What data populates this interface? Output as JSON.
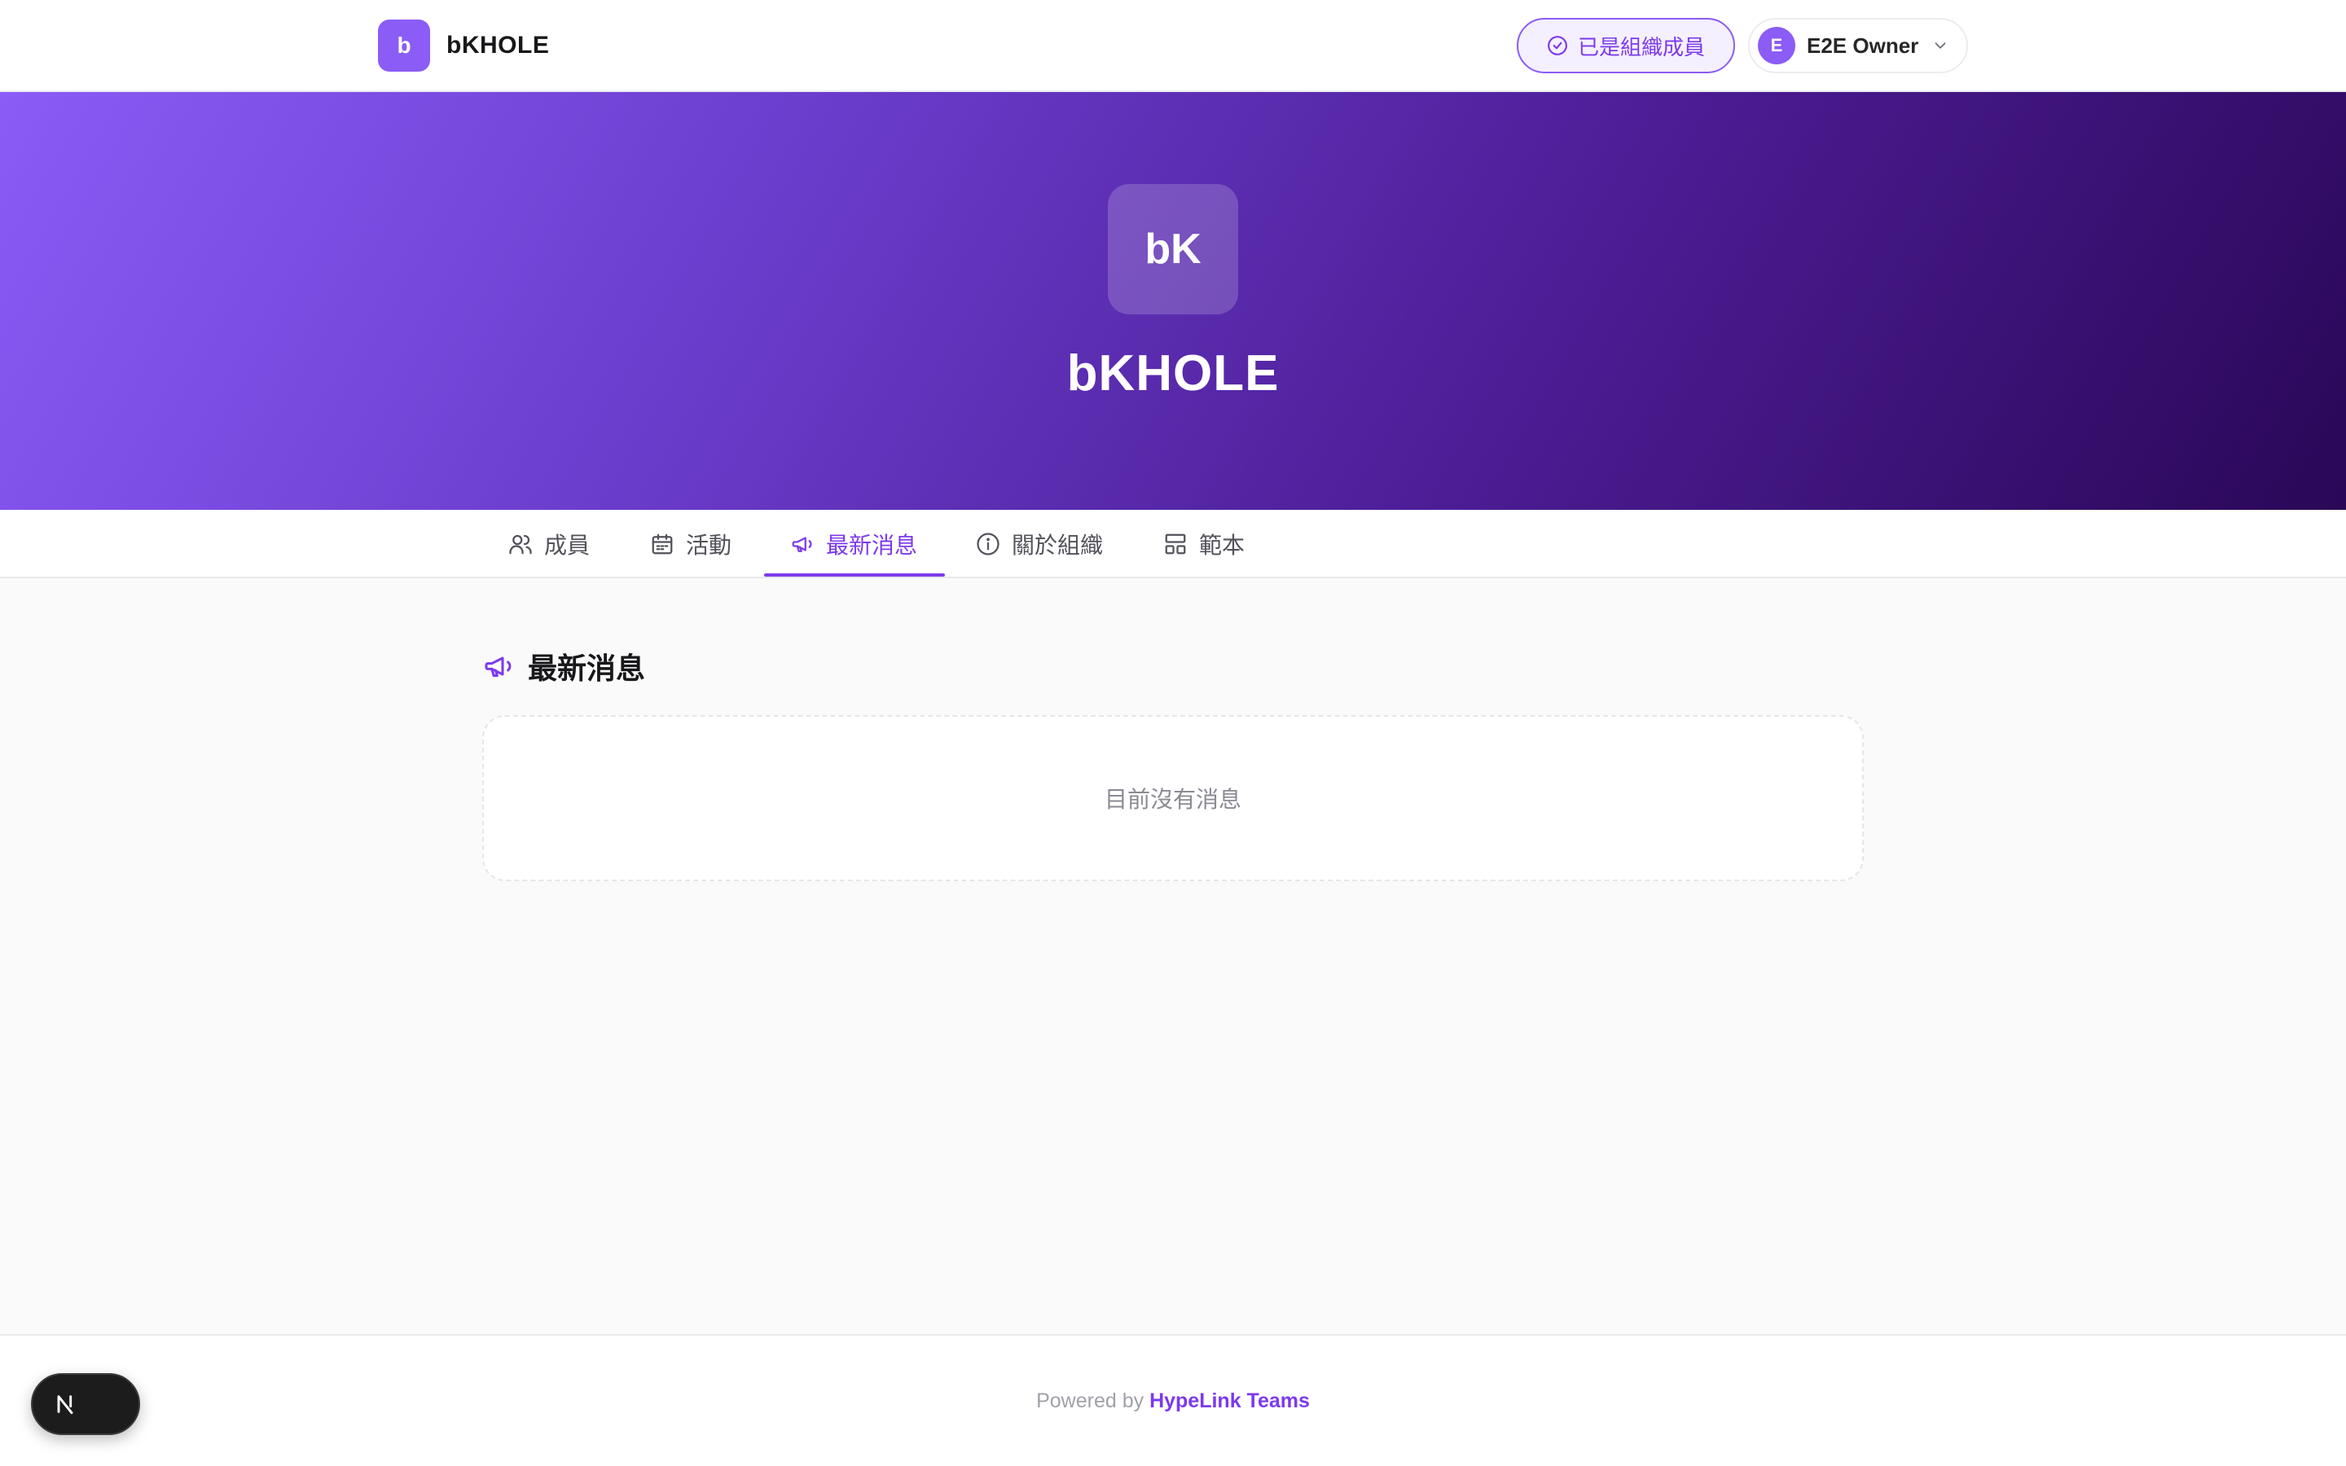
{
  "header": {
    "brand_initial": "b",
    "brand_name": "bKHOLE",
    "member_status": "已是組織成員",
    "user": {
      "initial": "E",
      "name": "E2E Owner"
    }
  },
  "hero": {
    "logo_text": "bK",
    "title": "bKHOLE"
  },
  "tabs": [
    {
      "label": "成員",
      "icon": "users-icon"
    },
    {
      "label": "活動",
      "icon": "calendar-icon"
    },
    {
      "label": "最新消息",
      "icon": "megaphone-icon",
      "active": true
    },
    {
      "label": "關於組織",
      "icon": "info-icon"
    },
    {
      "label": "範本",
      "icon": "template-icon"
    }
  ],
  "section": {
    "title": "最新消息",
    "empty_message": "目前沒有消息"
  },
  "footer": {
    "prefix": "Powered by",
    "link": "HypeLink Teams"
  },
  "dev_badge": {
    "letter": "N"
  },
  "colors": {
    "accent": "#7c3aed",
    "accent_light": "#8b5cf6",
    "hero_dark": "#2a0757"
  }
}
